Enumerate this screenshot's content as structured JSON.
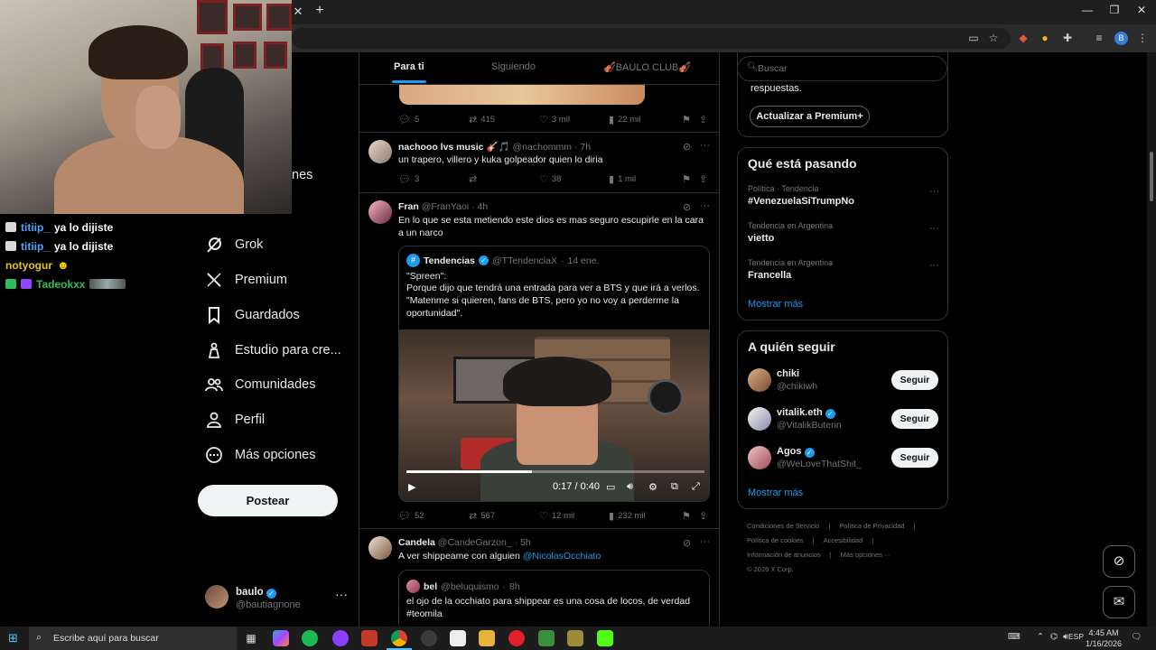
{
  "browser": {
    "tab_close_glyph": "✕",
    "new_tab_glyph": "+"
  },
  "chat": {
    "messages": [
      {
        "user": "titiip_",
        "text": "ya lo dijiste",
        "user_color": "#4aa3ff"
      },
      {
        "user": "titiip_",
        "text": "ya lo dijiste",
        "user_color": "#4aa3ff"
      },
      {
        "user": "notyogur",
        "text": "",
        "user_color": "#e6c229"
      },
      {
        "user": "Tadeokxx",
        "text": "",
        "user_color": "#2ebd59"
      }
    ]
  },
  "nav": {
    "partial_label": "nes",
    "items": [
      {
        "label": "Grok",
        "icon": "grok-icon"
      },
      {
        "label": "Premium",
        "icon": "x-logo-icon"
      },
      {
        "label": "Guardados",
        "icon": "bookmark-icon"
      },
      {
        "label": "Estudio para cre...",
        "icon": "creator-studio-icon"
      },
      {
        "label": "Comunidades",
        "icon": "communities-icon"
      },
      {
        "label": "Perfil",
        "icon": "profile-icon"
      },
      {
        "label": "Más opciones",
        "icon": "more-options-icon"
      }
    ],
    "post_button": "Postear",
    "account": {
      "name": "baulo",
      "handle": "@bautiagnone"
    }
  },
  "timeline": {
    "tabs": [
      "Para ti",
      "Siguiendo",
      "🎻BAULO CLUB🎻"
    ],
    "active_tab": 0,
    "prev_post_actions": {
      "replies": "5",
      "reposts": "415",
      "likes": "3 mil",
      "views": "22 mil"
    },
    "posts": [
      {
        "name": "nachooo lvs music 🎸🎵",
        "handle": "@nachommm",
        "time": "7h",
        "text": "un trapero, villero y kuka golpeador quien lo diria",
        "actions": {
          "replies": "3",
          "reposts": "",
          "likes": "38",
          "views": "1 mil"
        }
      },
      {
        "name": "Fran",
        "handle": "@FranYaoi",
        "time": "4h",
        "text": "En lo que se esta metiendo este dios es mas seguro escupirle en la cara a un narco",
        "quote": {
          "name": "Tendencias",
          "handle": "@TTendenciaX",
          "time": "14 ene.",
          "text_lines": [
            "\"Spreen\":",
            "Porque dijo que tendrá una entrada para ver a BTS y que irá a verlos.",
            "\"Matenme si quieren, fans de BTS, pero yo no voy a perderme la oportunidad\"."
          ],
          "video": {
            "time": "0:17 / 0:40",
            "progress": 0.42
          }
        },
        "actions": {
          "replies": "52",
          "reposts": "567",
          "likes": "12 mil",
          "views": "232 mil"
        }
      },
      {
        "name": "Candela",
        "handle": "@CandeGarzon_",
        "time": "5h",
        "text": "A ver shippeame con alguien",
        "mention": "@NicolasOcchiato",
        "quote": {
          "name": "bel",
          "handle": "@beluquismo",
          "time": "8h",
          "text_lines": [
            "el ojo de la occhiato para shippear es una cosa de locos, de verdad",
            "#teomila"
          ]
        }
      }
    ]
  },
  "right": {
    "search_placeholder": "Buscar",
    "premium": {
      "text": "respuestas.",
      "button": "Actualizar a Premium+"
    },
    "trends": {
      "title": "Qué está pasando",
      "items": [
        {
          "category": "Política · Tendencia",
          "name": "#VenezuelaSiTrumpNo"
        },
        {
          "category": "Tendencia en Argentina",
          "name": "vietto"
        },
        {
          "category": "Tendencia en Argentina",
          "name": "Francella"
        }
      ],
      "show_more": "Mostrar más"
    },
    "follow": {
      "title": "A quién seguir",
      "items": [
        {
          "name": "chiki",
          "handle": "@chikiwh",
          "verified": false,
          "button": "Seguir"
        },
        {
          "name": "vitalik.eth",
          "handle": "@VitalikButerin",
          "verified": true,
          "button": "Seguir"
        },
        {
          "name": "Agos",
          "handle": "@WeLoveThatShit_",
          "verified": true,
          "button": "Seguir"
        }
      ],
      "show_more": "Mostrar más"
    },
    "footer": [
      [
        "Condiciones de Servicio",
        "|",
        "Política de Privacidad",
        "|"
      ],
      [
        "Política de cookies",
        "|",
        "Accesibilidad",
        "|"
      ],
      [
        "Información de anuncios",
        "|",
        "Más opciones ···"
      ],
      [
        "© 2026 X Corp."
      ]
    ]
  },
  "taskbar": {
    "search_placeholder": "Escribe aquí para buscar",
    "language": "ESP",
    "time": "4:45 AM",
    "date": "1/16/2026"
  },
  "colors": {
    "accent": "#1d9bf0",
    "background": "#000000",
    "border": "#2f3336",
    "muted": "#71767b"
  }
}
